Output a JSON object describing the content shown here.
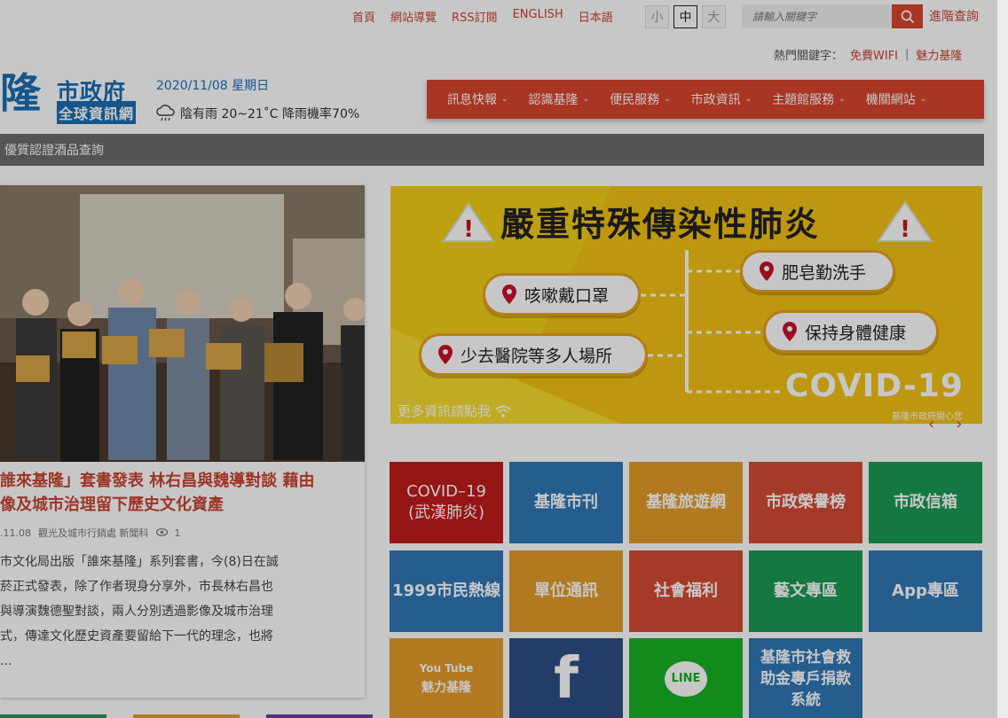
{
  "top_nav": {
    "links": [
      "首頁",
      "網站導覽",
      "RSS訂閱",
      "ENGLISH",
      "日本語"
    ],
    "font_sizes": [
      "小",
      "中",
      "大"
    ],
    "active_font_size": "中",
    "search_placeholder": "請輸入關鍵字",
    "advanced_search": "進階查詢"
  },
  "hot_keywords": {
    "label": "熱門關鍵字：",
    "items": [
      "免費WIFI",
      "魅力基隆"
    ],
    "separator": "|"
  },
  "logo": {
    "big_char": "隆",
    "main": "市政府",
    "sub": "全球資訊網"
  },
  "header": {
    "date": "2020/11/08 星期日",
    "weather": "陰有雨 20~21˚C 降雨機率70%"
  },
  "main_nav": {
    "items": [
      "訊息快報",
      "認識基隆",
      "便民服務",
      "市政資訊",
      "主題館服務",
      "機關網站"
    ]
  },
  "gray_bar": {
    "text": "優質認證酒品查詢"
  },
  "news": {
    "title_line1": "誰來基隆」套書發表 林右昌與魏導對談 藉由",
    "title_line2": "像及城市治理留下歷史文化資產",
    "date": ".11.08",
    "dept": "觀光及城市行銷處 新聞科",
    "views": "1",
    "body": "市文化局出版「誰來基隆」系列套書，今(8)日在誠\n菸正式發表，除了作者現身分享外，市長林右昌也\n與導演魏德聖對談，兩人分別透過影像及城市治理\n式，傳達文化歷史資產要留給下一代的理念，也將\n..."
  },
  "banner": {
    "title": "嚴重特殊傳染性肺炎",
    "pills": [
      "咳嗽戴口罩",
      "肥皂勤洗手",
      "保持身體健康",
      "少去醫院等多人場所"
    ],
    "covid": "COVID-19",
    "more": "更多資訊請點我",
    "credit": "基隆市政府關心您",
    "prev": "‹",
    "next": "›"
  },
  "tiles": [
    {
      "label": "COVID–19\n(武漢肺炎)",
      "color": "red"
    },
    {
      "label": "基隆市刊",
      "color": "blue"
    },
    {
      "label": "基隆旅遊網",
      "color": "orange"
    },
    {
      "label": "市政榮譽榜",
      "color": "tomato"
    },
    {
      "label": "市政信箱",
      "color": "green"
    },
    {
      "label": "1999市民熱線",
      "color": "blue"
    },
    {
      "label": "單位通訊",
      "color": "orange"
    },
    {
      "label": "社會福利",
      "color": "tomato"
    },
    {
      "label": "藝文專區",
      "color": "green"
    },
    {
      "label": "App專區",
      "color": "blue"
    },
    {
      "label": "魅力基隆",
      "icon_text": "You Tube",
      "color": "orange"
    },
    {
      "label": "",
      "icon": "facebook-icon",
      "color": "navy"
    },
    {
      "label": "LINE",
      "icon": "line-icon",
      "color": "lime"
    },
    {
      "label": "基隆市社會救\n助金專戶捐款\n系統",
      "color": "blue"
    }
  ]
}
